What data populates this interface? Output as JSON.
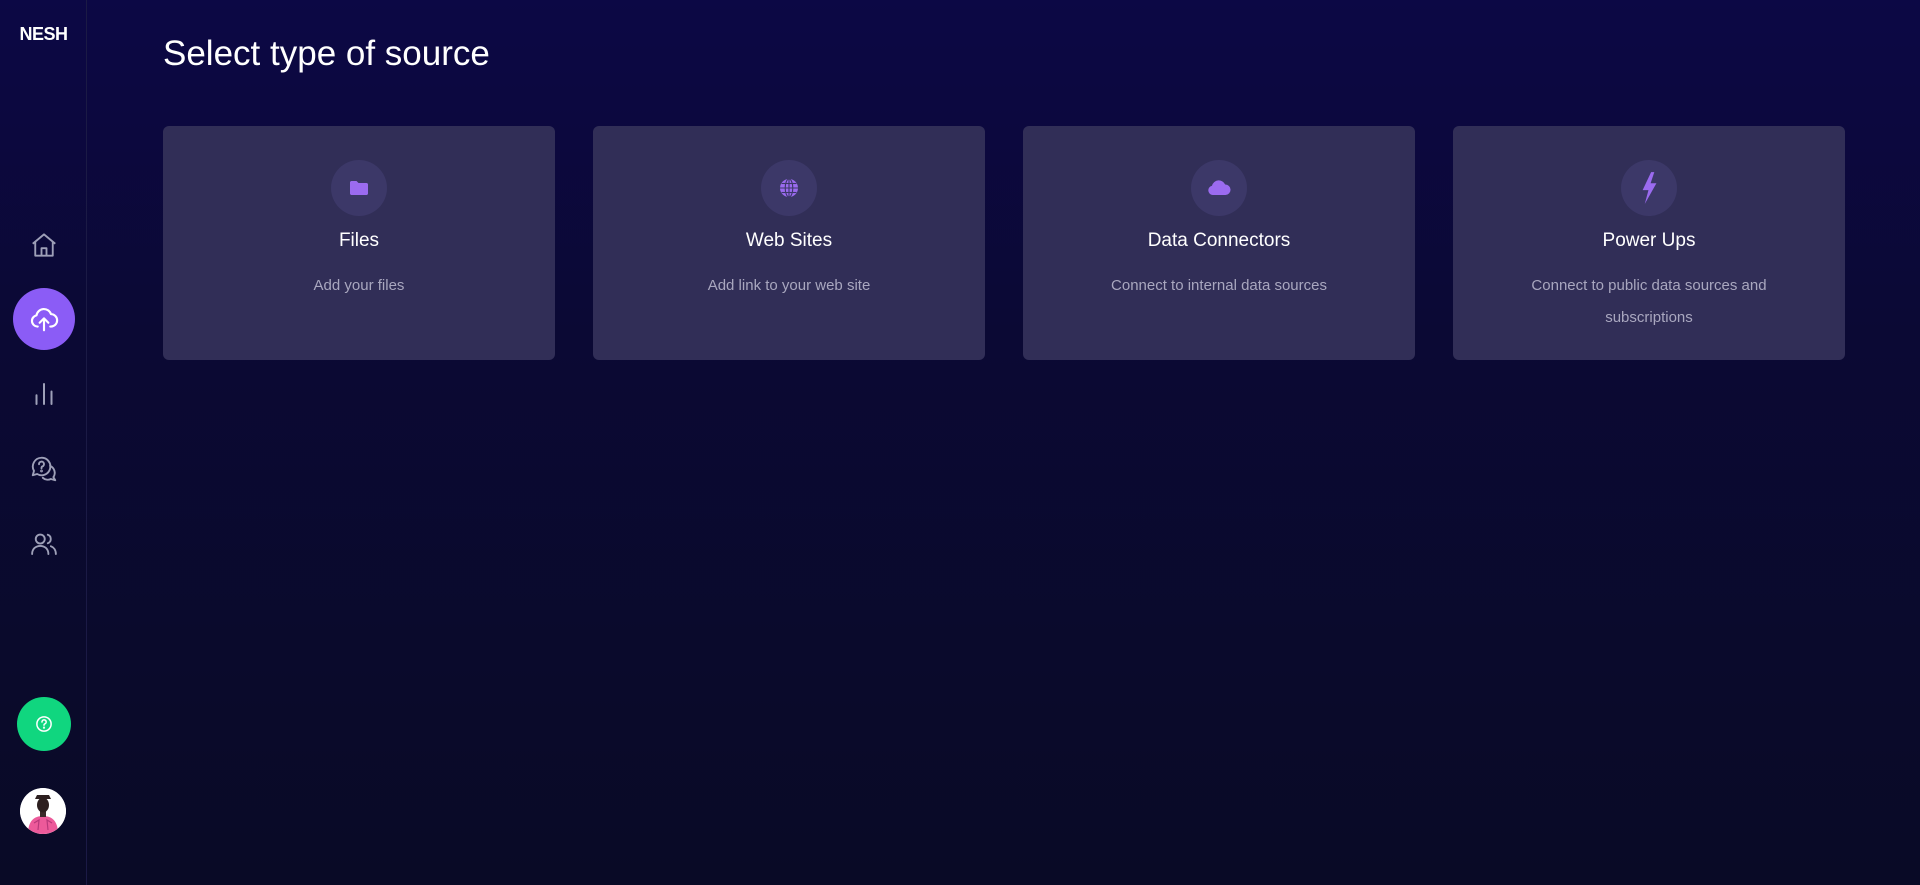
{
  "brand": {
    "logo_text": "NESH"
  },
  "sidebar": {
    "items": [
      {
        "name": "home",
        "icon": "home-icon"
      },
      {
        "name": "upload",
        "icon": "cloud-upload-icon",
        "active": true
      },
      {
        "name": "analytics",
        "icon": "bar-chart-icon"
      },
      {
        "name": "questions",
        "icon": "question-chat-icon"
      },
      {
        "name": "users",
        "icon": "users-icon"
      }
    ],
    "help_icon": "help-circle-icon",
    "accent_color": "#8b5cf6",
    "help_color": "#10d67f"
  },
  "main": {
    "title": "Select type of source",
    "cards": [
      {
        "title": "Files",
        "description": "Add your files",
        "icon": "folder-icon"
      },
      {
        "title": "Web Sites",
        "description": "Add link to your web site",
        "icon": "globe-icon"
      },
      {
        "title": "Data Connectors",
        "description": "Connect to internal data sources",
        "icon": "cloud-icon"
      },
      {
        "title": "Power Ups",
        "description": "Connect to public data sources and subscriptions",
        "icon": "lightning-icon"
      }
    ]
  }
}
